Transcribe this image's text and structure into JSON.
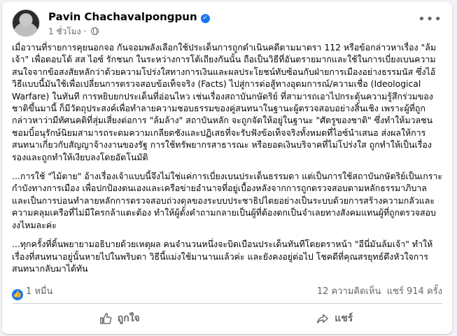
{
  "post": {
    "author": "Pavin Chachavalpongpun",
    "time": "1 ชั่วโมง",
    "paragraphs": [
      "เมื่อวานที่รายการคุยนอกจอ กันจอมพลังเลือกใช้ประเด็นการถูกดำเนินคดีตามมาตรา 112 หรือข้อกล่าวหาเรื่อง \"ล้มเจ้า\" เพื่อตอบโต้ สส ไอซ์ รักชนก ในระหว่างการโต้เถียงกันนั้น ถือเป็นวิธีที่อันตรายมากและใช้ในการเบี่ยงเบนความสนใจจากข้อสงสัยหลักว่าด้วยความโปร่งใสทางการเงินและผลประโยชน์ทับซ้อนกับฝ่ายการเมืองอย่างธรรมนัส ซึ่งไอ้วิธีแบบนี้มันใช้เพื่อเปลี่ยนการตรวจสอบข้อเท็จจริง (Facts) ไปสู่การต่อสู้ทางอุดมการณ์/ความเชื่อ (Ideological Warfare) ในทันที การหยิบยกประเด็นที่อ่อนไหว เช่นเรื่องสถาบันกษัตริย์ ที่สามารถเอาไปกระตุ้นความรู้สึกร่วมของชาติขึ้นมานี้ ก็มีวัตถุประสงค์เพื่อทำลายความชอบธรรมของคู่สนทนาในฐานะผู้ตรวจสอบอย่างสิ้นเชิง เพราะผู้ที่ถูกกล่าวหาว่ามีทัศนคติที่สุ่มเสี่ยงต่อการ \"ล้มล้าง\" สถาบันหลัก จะถูกจัดให้อยู่ในฐานะ \"ศัตรูของชาติ\" ซึ่งทำให้มวลชนชอมบิ้อนุรักษ์นิยมสามารถระดมความเกลียดชังและปฏิเสธที่จะรับฟังข้อเท็จจริงทั้งหมดที่ไอซ์นำเสนอ ส่งผลให้การสนทนาเกี่ยวกับสัญญาจ้างงานของรัฐ การใช้ทรัพยากรสาธารณะ หรือยอดเงินบริจาคที่ไม่โปร่งใส ถูกทำให้เป็นเรื่องรองและถูกทำให้เงียบลงโดยอัตโนมัติ",
      "...การใช้ \"ไม้ตาย\" อ้างเรื่องเจ้าแบบนี้จึงไม่ใช่แค่การเบี่ยงเบนประเด็นธรรมดา แต่เป็นการใช้สถาบันกษัตริย์เป็นเกราะกำบังทางการเมือง เพื่อปกป้องตนเองและเครือข่ายอำนาจที่อยู่เบื้องหลังจากการถูกตรวจสอบตามหลักธรรมาภิบาล และเป็นการบ่อนทำลายหลักการตรวจสอบถ่วงดุลของระบบประชาธิปไตยอย่างเป็นระบบด้วยการสร้างความกลัวและความคลุมเครือที่ไม่มีใครกล้าแตะต้อง ทำให้ผู้ตั้งคำถามกลายเป็นผู้ที่ต้องตกเป็นจำเลยทางสังคมแทนผู้ที่ถูกตรวจสอบ งงไหมละค่ะ",
      "...ทุกครั้งที่ดิ้นพยายามอธิบายด้วยเหตุผล คนจำนวนหนึ่งจะบิดเบือนประเด็นทันทีโดยตราหน้า \"อีนี่มันล้มเจ้า\" ทำให้เรื่องที่สนทนาอยู่นั้นหายไปในพริบตา วิธีนี้แม่งใช้มานานแล้วค่ะ และยังคงอยู่ต่อไป โชคดีที่คุณสรยุทธ์ดึงหัวใจการสนทนากลับมาได้ทัน"
    ]
  },
  "stats": {
    "likes": "1 หมื่น",
    "comments": "12 ความคิดเห็น",
    "shares": "แชร์ 914 ครั้ง"
  },
  "actions": {
    "like": "ถูกใจ",
    "share": "แชร์"
  },
  "icons": {
    "verified": "verified-badge-icon",
    "globe": "globe-icon",
    "more": "more-options-icon",
    "like_badge": "like-reaction-icon",
    "like_button": "thumbs-up-icon",
    "share_button": "share-arrow-icon"
  },
  "colors": {
    "accent": "#1877f2",
    "secondary_text": "#65676b",
    "background": "#f0f2f5"
  }
}
